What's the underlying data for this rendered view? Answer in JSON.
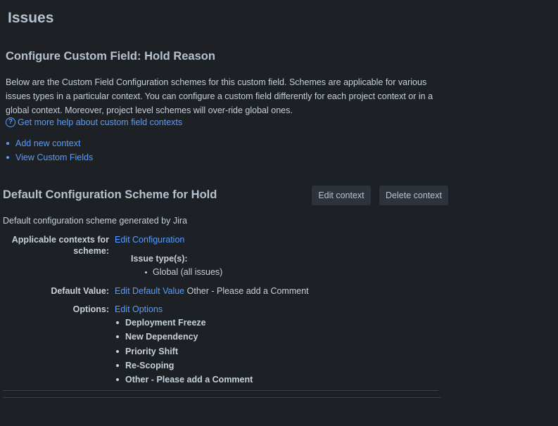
{
  "page": {
    "title": "Issues"
  },
  "field": {
    "title": "Configure Custom Field: Hold Reason",
    "description": "Below are the Custom Field Configuration schemes for this custom field. Schemes are applicable for various issues types in a particular context. You can configure a custom field differently for each project context or in a global context. Moreover, project level schemes will over-ride global ones.",
    "help_link": "Get more help about custom field contexts",
    "actions": [
      "Add new context",
      "View Custom Fields"
    ]
  },
  "scheme": {
    "title": "Default Configuration Scheme for Hold",
    "edit_context": "Edit context",
    "delete_context": "Delete context",
    "description": "Default configuration scheme generated by Jira",
    "contexts_label_line1": "Applicable contexts for",
    "contexts_label_line2": "scheme:",
    "edit_configuration": "Edit Configuration",
    "issue_types_label": "Issue type(s):",
    "issue_types": [
      "Global (all issues)"
    ],
    "default_value_label": "Default Value:",
    "edit_default_value": "Edit Default Value",
    "default_value": "Other - Please add a Comment",
    "options_label": "Options:",
    "edit_options": "Edit Options",
    "options": [
      "Deployment Freeze",
      "New Dependency",
      "Priority Shift",
      "Re-Scoping",
      "Other - Please add a Comment"
    ]
  },
  "colors": {
    "background": "#1d2125",
    "link": "#579dff",
    "text": "#c7d1db",
    "button": "#2c333a"
  }
}
